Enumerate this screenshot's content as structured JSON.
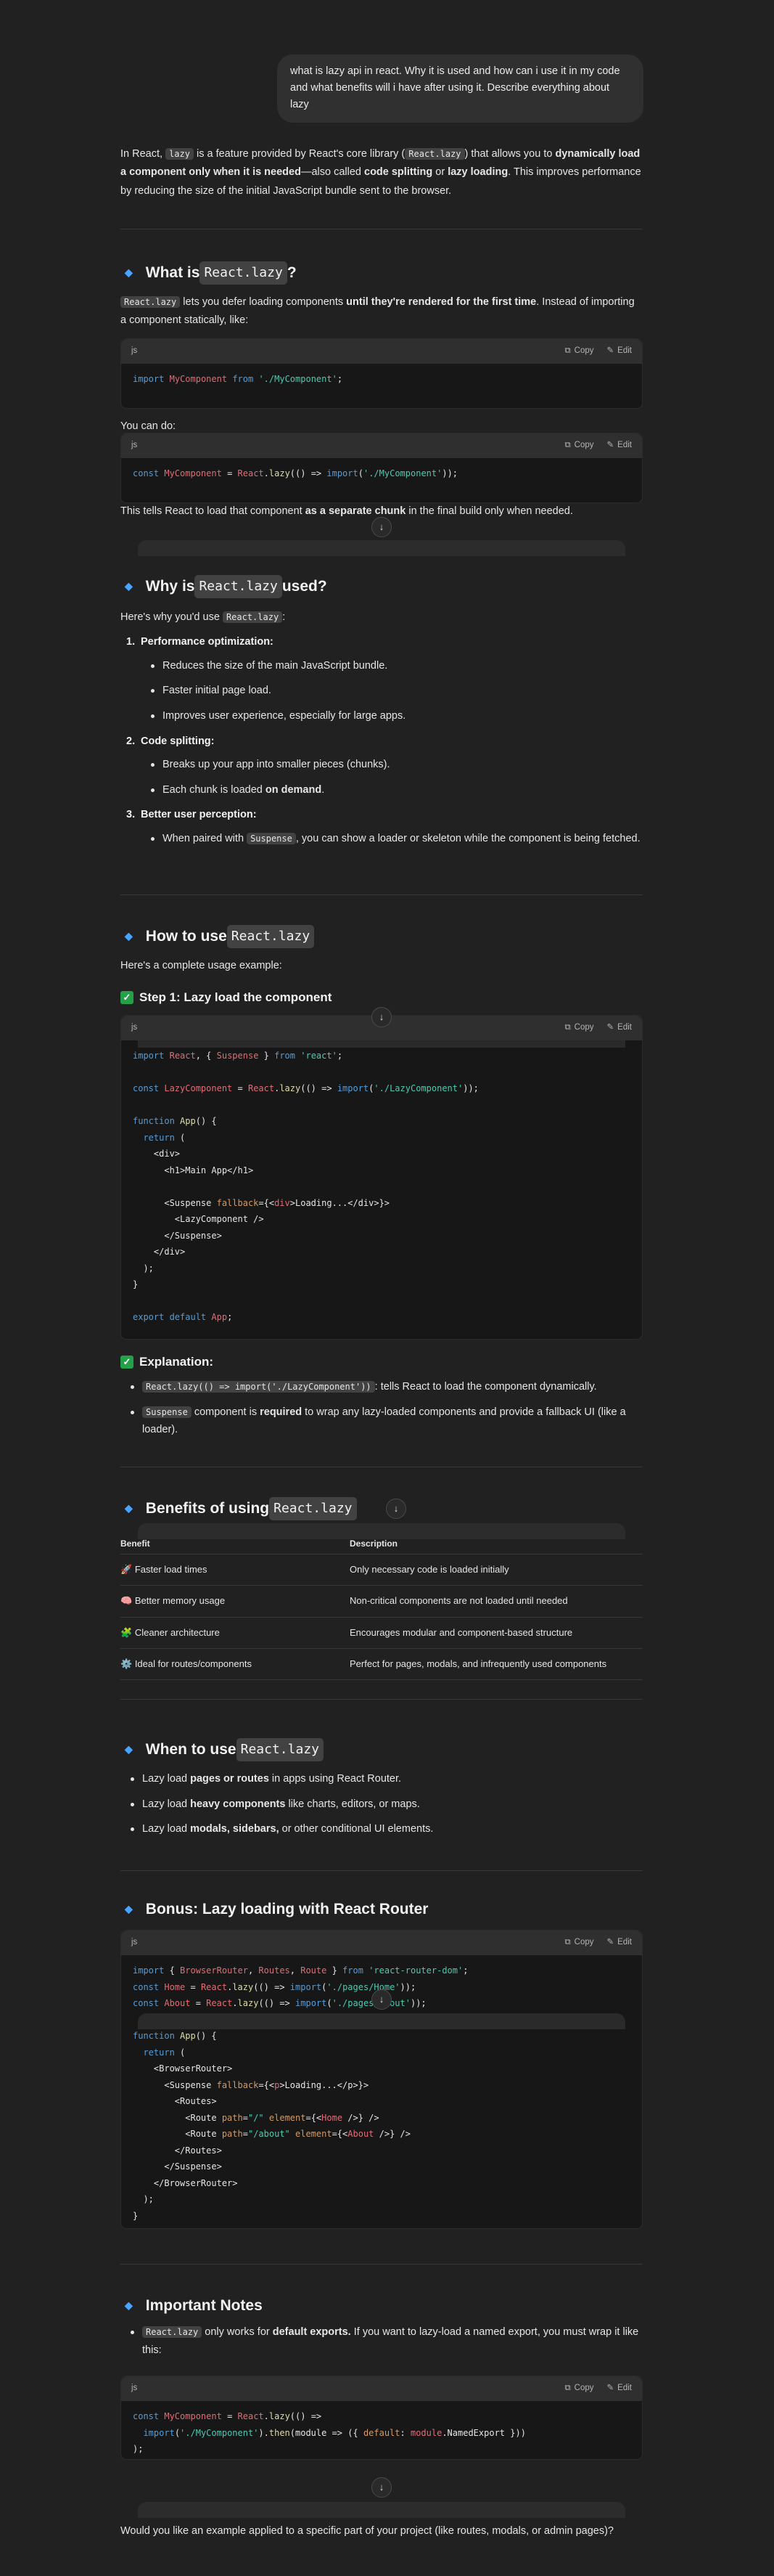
{
  "user_message": "what is lazy api in react. Why it is used and how can i use it in my code and what benefits will i have after using it. Describe everything about lazy",
  "intro": {
    "p1": "In React, ",
    "code1": "lazy",
    "p2": " is a feature provided by React's core library (",
    "code2": "React.lazy",
    "p3": ") that allows you to ",
    "b1": "dynamically load a component only when it is needed",
    "p4": "—also called ",
    "b2": "code splitting",
    "p5": " or ",
    "b3": "lazy loading",
    "p6": ". This improves performance by reducing the size of the initial JavaScript bundle sent to the browser."
  },
  "s1": {
    "title_pre": "What is ",
    "title_code": "React.lazy",
    "title_post": "?",
    "p_code": "React.lazy",
    "p1": " lets you defer loading components ",
    "p_b": "until they're rendered for the first time",
    "p2": ". Instead of importing a component statically, like:",
    "lang": "js",
    "copy": "Copy",
    "edit": "Edit",
    "code1": "import MyComponent from './MyComponent';",
    "youcan": "You can do:",
    "code2": "const MyComponent = React.lazy(() => import('./MyComponent'));",
    "tell1": "This tells React to load that component ",
    "tell_b": "as a separate chunk",
    "tell2": " in the final build only when needed."
  },
  "s2": {
    "title_pre": "Why is ",
    "title_code": "React.lazy",
    "title_post": " used?",
    "intro": "Here's why you'd use ",
    "intro_code": "React.lazy",
    "intro_post": ":",
    "i1": "Performance optimization:",
    "i1a": "Reduces the size of the main JavaScript bundle.",
    "i1b": "Faster initial page load.",
    "i1c": "Improves user experience, especially for large apps.",
    "i2": "Code splitting:",
    "i2a": "Breaks up your app into smaller pieces (chunks).",
    "i2b": "Each chunk is loaded ",
    "i2b_b": "on demand",
    "i2b_post": ".",
    "i3": "Better user perception:",
    "i3a": "When paired with ",
    "i3a_code": "Suspense",
    "i3a_post": ", you can show a loader or skeleton while the component is being fetched.",
    "n1": "1.",
    "n2": "2.",
    "n3": "3."
  },
  "s3": {
    "title_pre": "How to use ",
    "title_code": "React.lazy",
    "example": "Here's a complete usage example:",
    "step1": "Step 1: Lazy load the component",
    "expl": "Explanation:",
    "e1_code": "React.lazy(() => import('./LazyComponent'))",
    "e1": ": tells React to load the component dynamically.",
    "e2_code": "Suspense",
    "e2": " component is ",
    "e2_b": "required",
    "e2_post": " to wrap any lazy-loaded components and provide a fallback UI (like a loader).",
    "check": "✓"
  },
  "s4": {
    "title_pre": "Benefits of using ",
    "title_code": "React.lazy",
    "col1": "Benefit",
    "col2": "Description",
    "rows": [
      {
        "icon": "🚀",
        "b": "Faster load times",
        "d": "Only necessary code is loaded initially"
      },
      {
        "icon": "🧠",
        "b": "Better memory usage",
        "d": "Non-critical components are not loaded until needed"
      },
      {
        "icon": "🧩",
        "b": "Cleaner architecture",
        "d": "Encourages modular and component-based structure"
      },
      {
        "icon": "⚙️",
        "b": "Ideal for routes/components",
        "d": "Perfect for pages, modals, and infrequently used components"
      }
    ]
  },
  "s5": {
    "title_pre": "When to use ",
    "title_code": "React.lazy",
    "l1": "Lazy load ",
    "l1b": "pages or routes",
    "l1p": " in apps using React Router.",
    "l2": "Lazy load ",
    "l2b": "heavy components",
    "l2p": " like charts, editors, or maps.",
    "l3": "Lazy load ",
    "l3b": "modals, sidebars,",
    "l3p": " or other conditional UI elements."
  },
  "s6": {
    "title": "Bonus: Lazy loading with React Router"
  },
  "s7": {
    "title": "Important Notes",
    "n1_code": "React.lazy",
    "n1": " only works for ",
    "n1_b": "default exports.",
    "n1_post": " If you want to lazy-load a named export, you must wrap it like this:"
  },
  "closing": "Would you like an example applied to a specific part of your project (like routes, modals, or admin pages)?",
  "arrow": "↓"
}
